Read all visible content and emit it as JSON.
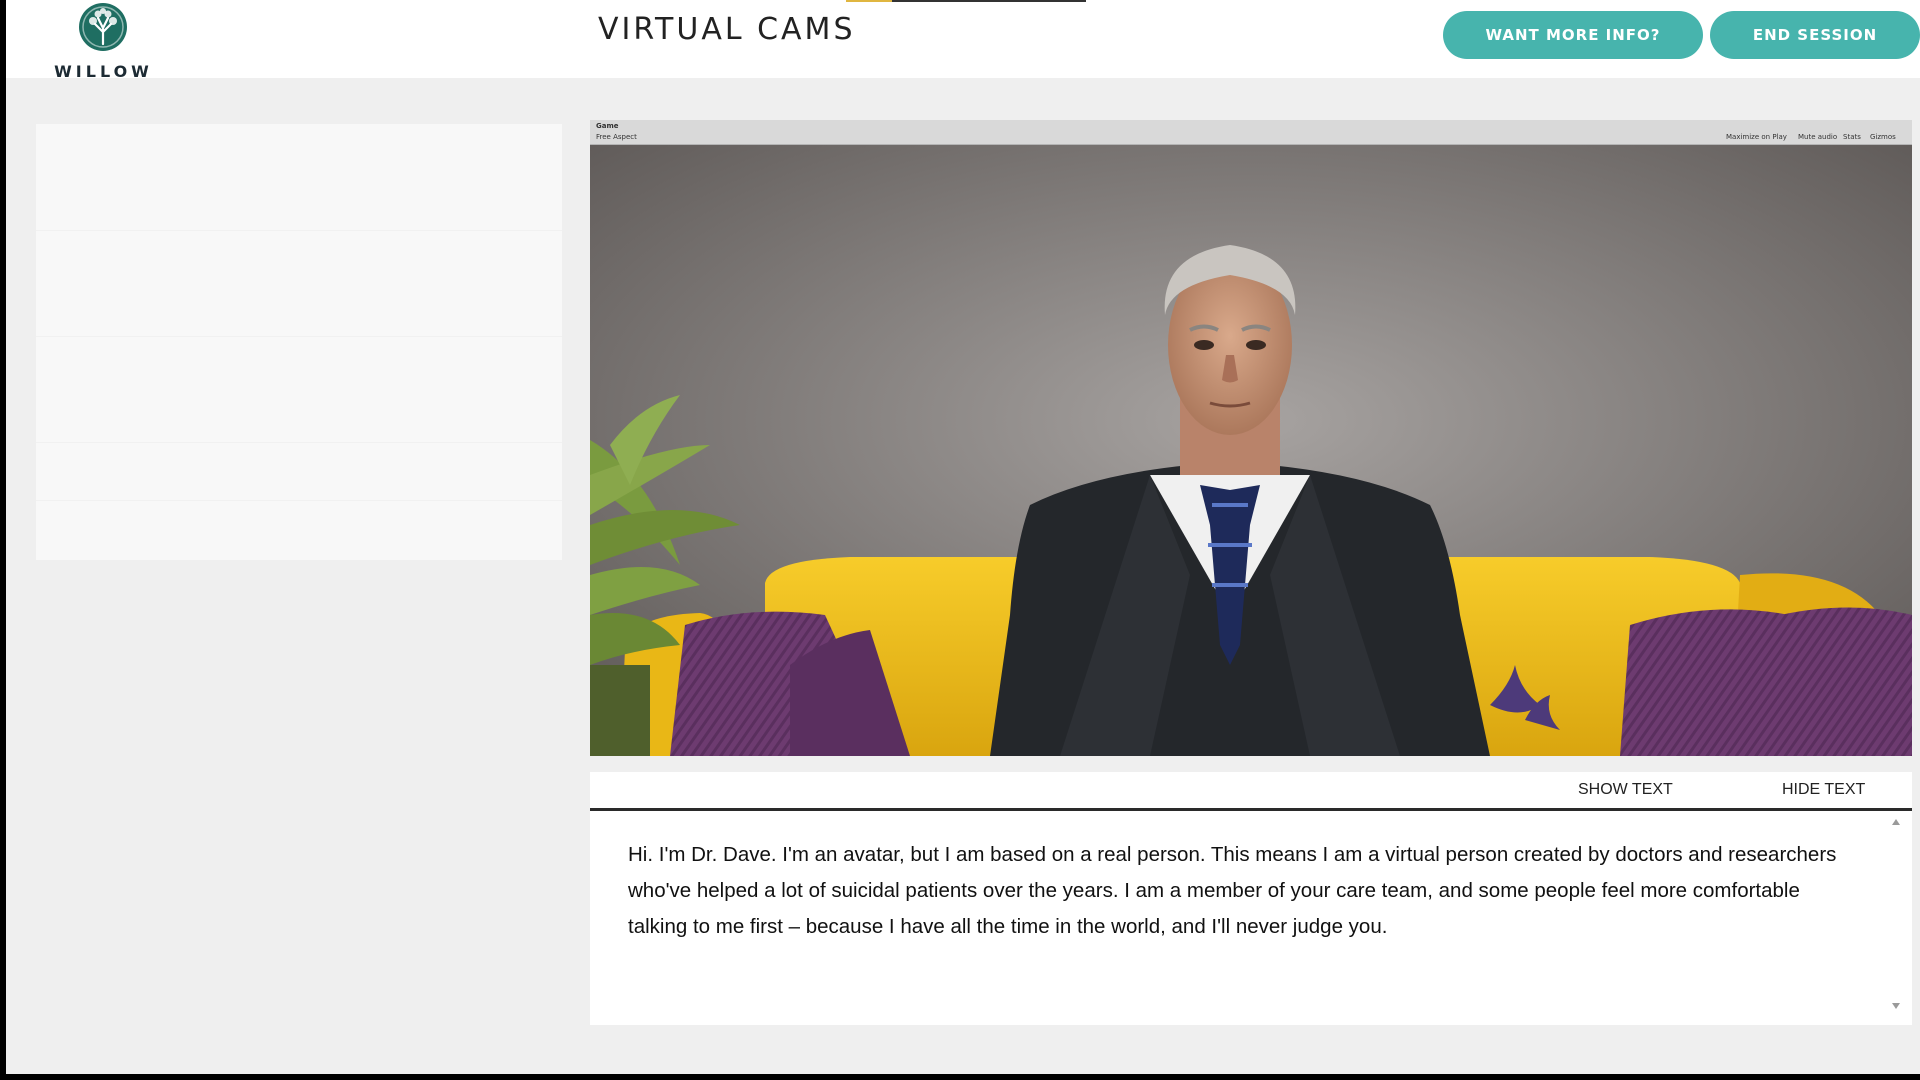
{
  "header": {
    "logo_text": "WILLOW",
    "title": "VIRTUAL CAMS",
    "info_button": "WANT MORE INFO?",
    "end_button": "END SESSION"
  },
  "video": {
    "tab_label": "Game",
    "aspect_label": "Free Aspect",
    "toolbar": [
      "Maximize on Play",
      "Mute audio",
      "Stats",
      "Gizmos"
    ]
  },
  "transcript": {
    "show_label": "SHOW TEXT",
    "hide_label": "HIDE TEXT",
    "text": "Hi. I'm Dr. Dave. I'm an avatar, but I am based on a real person. This means I am a virtual person created by doctors and researchers who've helped a lot of suicidal patients over the years. I am a member of your care team, and some people feel more comfortable talking to me first – because I have all the time in the world, and I'll never judge you."
  },
  "colors": {
    "accent": "#47b4ad",
    "background": "#efefef",
    "couch": "#f2c11e",
    "pillow": "#6a3a6e"
  },
  "icons": [
    "willow-tree-logo-icon",
    "scroll-up-icon",
    "scroll-down-icon"
  ]
}
